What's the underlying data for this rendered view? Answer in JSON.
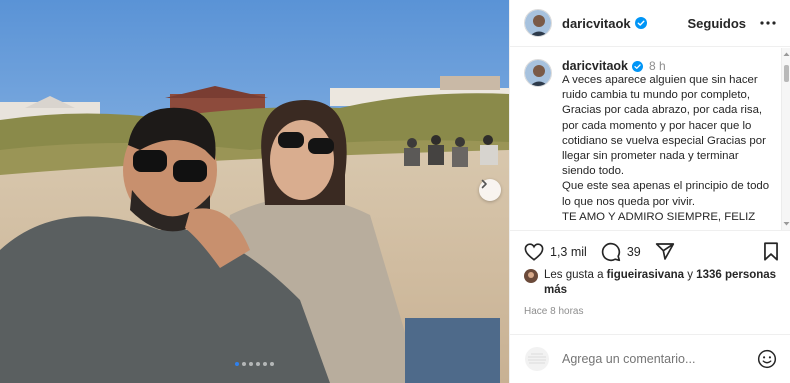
{
  "post": {
    "username": "daricvitaok",
    "follow_state": "Seguidos",
    "time_ago": "8 h",
    "caption": "A veces aparece alguien que sin hacer ruido cambia tu mundo por completo, Gracias por cada abrazo, por cada risa, por cada momento y por hacer que lo cotidiano se vuelva especial Gracias por llegar sin prometer nada y terminar siendo todo.\nQue  este sea apenas el principio de todo lo que nos queda por vivir.\nTE AMO Y ADMIRO SIEMPRE, FELIZ",
    "like_count": "1,3 mil",
    "comment_count": "39",
    "likes_prefix": "Les gusta a",
    "liked_by": "figueirasivana",
    "likes_connector": "y",
    "others": "1336 personas más",
    "posted_ago": "Hace 8 horas",
    "comment_placeholder": "Agrega un comentario..."
  },
  "carousel": {
    "slides": 6,
    "active_index": 0
  },
  "icons": {
    "verified": "verified-badge-icon",
    "more": "more-options-icon",
    "like": "heart-icon",
    "comment": "comment-icon",
    "share": "share-icon",
    "save": "bookmark-icon",
    "emoji": "emoji-icon",
    "next": "chevron-right-icon"
  },
  "colors": {
    "verified": "#0095f6",
    "text": "#262626",
    "muted": "#8e8e8e",
    "active_dot": "#2f80ed"
  }
}
